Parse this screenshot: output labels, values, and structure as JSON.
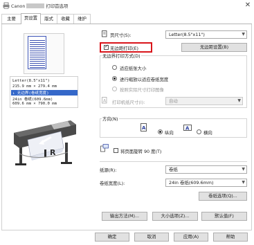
{
  "window": {
    "title_prefix": "Canon",
    "title_suffix": "打印首选项",
    "close_label": "✕"
  },
  "tabs": [
    {
      "label": "主要"
    },
    {
      "label": "页设置"
    },
    {
      "label": "版式"
    },
    {
      "label": "收藏"
    },
    {
      "label": "维护"
    }
  ],
  "preview": {
    "info_lines": [
      "Letter(8.5\"x11\")",
      "      215.9 mm × 279.4 mm",
      "  ↓ 无边界(卷纸宽度)",
      "24in 卷纸(609.6mm)",
      "      609.6 mm × 790.0 mm"
    ]
  },
  "page_size": {
    "label": "页尺寸(S):",
    "value": "Letter(8.5\"x11\")"
  },
  "borderless": {
    "label": "无边距打印(E)",
    "checked": true,
    "settings_button": "无边距设置(B)"
  },
  "borderless_method": {
    "group_title": "无边界打印方式(D)",
    "options": [
      {
        "label": "适应纸张大小",
        "selected": false,
        "disabled": false
      },
      {
        "label": "进行缩放以适应卷纸宽度",
        "selected": true,
        "disabled": false
      },
      {
        "label": "按照实际尺寸打印图像",
        "selected": false,
        "disabled": true
      }
    ],
    "printer_paper_size_label": "打印机纸尺寸(I):",
    "printer_paper_size_value": "自动"
  },
  "orientation": {
    "group_title": "方向(N)",
    "options": [
      {
        "label": "纵向",
        "selected": true
      },
      {
        "label": "横向",
        "selected": false
      }
    ]
  },
  "rotate": {
    "label": "将页面旋转 90 度(T)",
    "checked": false
  },
  "paper_source": {
    "label": "纸源(R):",
    "value": "卷纸"
  },
  "roll_width": {
    "label": "卷纸宽度(L):",
    "value": "24in 卷纸(609.6mm)"
  },
  "roll_options_button": "卷纸选项(Q)...",
  "bottom_buttons": {
    "output_method": "输出方法(M)...",
    "size_options": "大小选项(Z)...",
    "defaults": "默认值(F)"
  },
  "dialog_buttons": {
    "ok": "确定",
    "cancel": "取消",
    "apply": "应用(A)",
    "help": "帮助"
  },
  "colors": {
    "highlight": "#d9141a",
    "selection": "#3568c9",
    "paper_lines": "#3a4fb0"
  }
}
